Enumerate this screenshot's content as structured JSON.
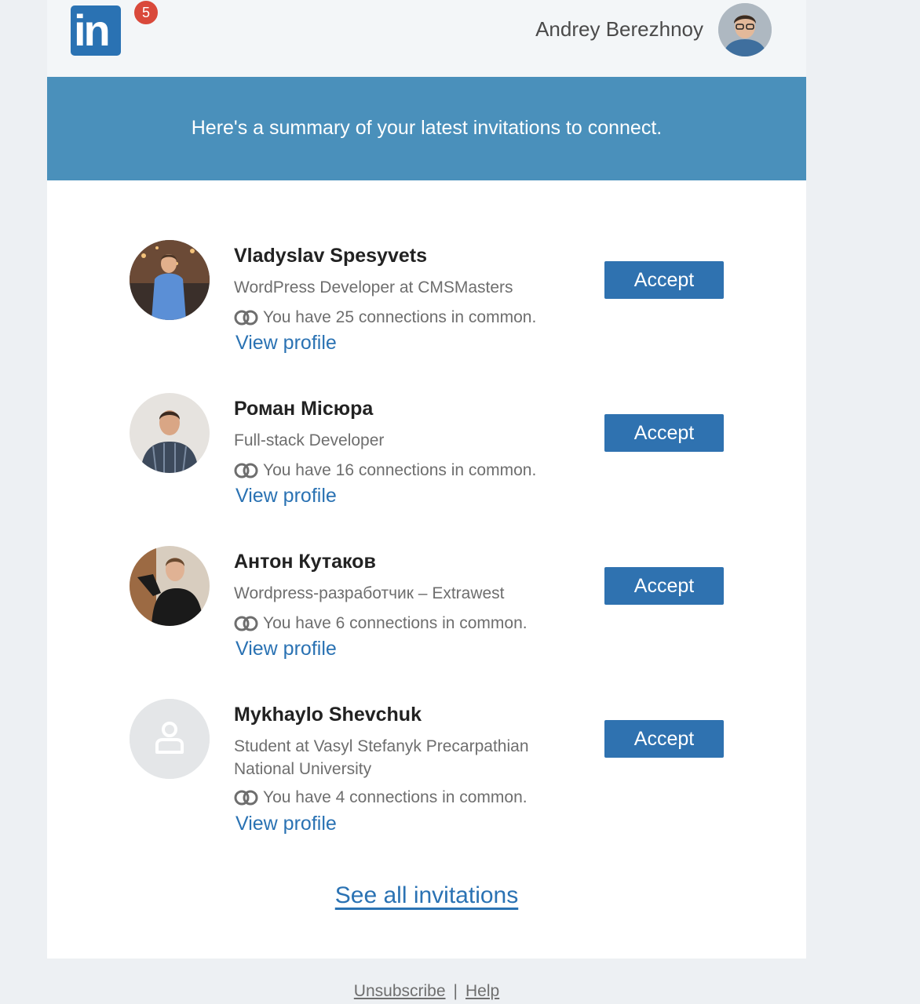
{
  "header": {
    "logo": "in",
    "badge_count": "5",
    "user_name": "Andrey Berezhnoy"
  },
  "banner": {
    "text": "Here's a summary of your latest invitations to connect."
  },
  "invitations": [
    {
      "name": "Vladyslav Spesyvets",
      "title": "WordPress Developer at CMSMasters",
      "common": "You have 25 connections in common.",
      "link": "View profile",
      "button": "Accept"
    },
    {
      "name": "Роман Місюра",
      "title": "Full-stack Developer",
      "common": "You have 16 connections in common.",
      "link": "View profile",
      "button": "Accept"
    },
    {
      "name": "Антон Кутаков",
      "title": "Wordpress-разработчик – Extrawest",
      "common": "You have 6 connections in common.",
      "link": "View profile",
      "button": "Accept"
    },
    {
      "name": "Mykhaylo Shevchuk",
      "title": "Student at Vasyl Stefanyk Precarpathian National University",
      "common": "You have 4 connections in common.",
      "link": "View profile",
      "button": "Accept"
    }
  ],
  "see_all": "See all invitations",
  "footer": {
    "unsubscribe": "Unsubscribe",
    "separator": "|",
    "help": "Help"
  }
}
